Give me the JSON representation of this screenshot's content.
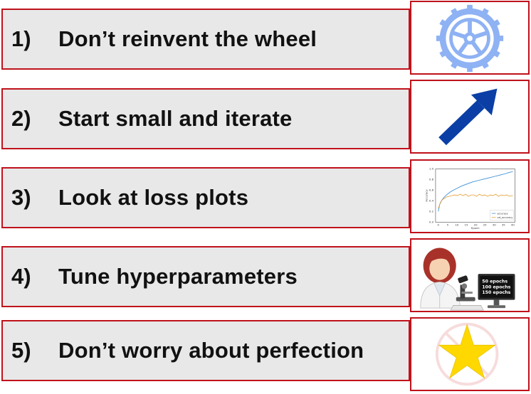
{
  "items": [
    {
      "number": "1)",
      "text": "Don’t reinvent the wheel",
      "icon": "wheel-icon"
    },
    {
      "number": "2)",
      "text": "Start small and iterate",
      "icon": "arrow-up-right-icon"
    },
    {
      "number": "3)",
      "text": "Look at loss plots",
      "icon": "loss-plot-thumbnail"
    },
    {
      "number": "4)",
      "text": "Tune hyperparameters",
      "icon": "scientist-microscope-icon"
    },
    {
      "number": "5)",
      "text": "Don’t worry about perfection",
      "icon": "star-icon"
    }
  ],
  "plot": {
    "ylabel": "Accuracy",
    "xlabel": "Epoch",
    "yticks": [
      "0.0",
      "0.2",
      "0.4",
      "0.6",
      "0.8",
      "1.0"
    ],
    "xticks": [
      "0",
      "5",
      "10",
      "15",
      "20",
      "25",
      "30",
      "35",
      "40"
    ],
    "legend": [
      "accuracy",
      "val_accuracy"
    ]
  },
  "monitor": {
    "lines": [
      "50 epochs",
      "100 epochs",
      "150 epochs"
    ]
  },
  "colors": {
    "border": "#c0121b",
    "row_bg": "#e8e8e8",
    "wheel": "#8eb2f3",
    "arrow": "#0b3fa6",
    "star": "#ffd800"
  }
}
